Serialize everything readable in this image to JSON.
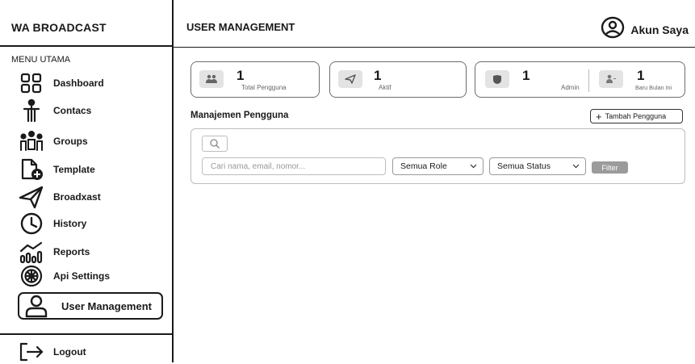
{
  "sidebar": {
    "brand": "WA BROADCAST",
    "menu_heading": "MENU UTAMA",
    "items": [
      {
        "label": "Dashboard",
        "icon": "grid-icon"
      },
      {
        "label": "Contacs",
        "icon": "person-icon"
      },
      {
        "label": "Groups",
        "icon": "group-icon"
      },
      {
        "label": "Template",
        "icon": "add-document-icon"
      },
      {
        "label": "Broadxast",
        "icon": "paper-plane-icon"
      },
      {
        "label": "History",
        "icon": "clock-icon"
      },
      {
        "label": "Reports",
        "icon": "chart-icon"
      },
      {
        "label": "Api Settings",
        "icon": "gear-icon"
      },
      {
        "label": "User Management",
        "icon": "user-icon",
        "active": true
      }
    ],
    "logout": {
      "label": "Logout",
      "icon": "logout-icon"
    }
  },
  "header": {
    "title": "USER MANAGEMENT",
    "account_label": "Akun Saya"
  },
  "stats": [
    {
      "value": "1",
      "label": "Total Pengguna",
      "icon": "users-icon"
    },
    {
      "value": "1",
      "label": "Aktif",
      "icon": "send-icon"
    },
    {
      "value": "1",
      "label": "Admin",
      "icon": "shield-icon"
    },
    {
      "value": "1",
      "label": "Baru Bulan Ini",
      "icon": "user-plus-icon"
    }
  ],
  "section": {
    "title": "Manajemen Pengguna",
    "add_button": "Tambah Pengguna"
  },
  "filters": {
    "search_placeholder": "Cari nama, email, nomor...",
    "role_select": "Semua Role",
    "status_select": "Semua Status",
    "filter_button": "Filter"
  },
  "colors": {
    "border": "#1a1a1a",
    "card_border": "#bdbdbd",
    "icon_box": "#e3e3e3",
    "filter_button": "#9b9b9b"
  }
}
